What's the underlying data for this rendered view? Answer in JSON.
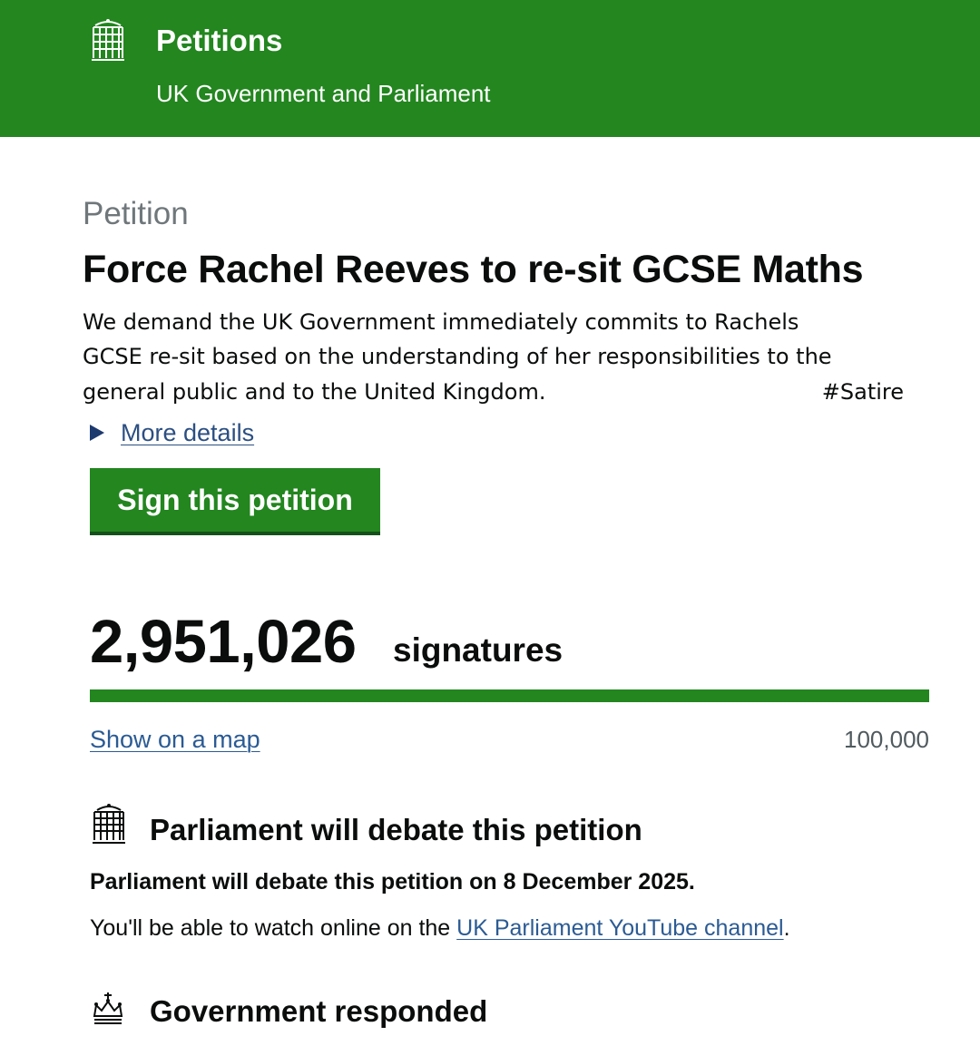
{
  "header": {
    "site_name": "Petitions",
    "subtitle": "UK Government and Parliament",
    "logo_icon": "portcullis-icon",
    "background_color": "#23861f"
  },
  "petition": {
    "caption": "Petition",
    "title": "Force Rachel Reeves to re-sit GCSE Maths",
    "description_lines": [
      "We demand the UK Government immediately commits to Rachels",
      "GCSE re-sit based on the understanding of her responsibilities to the",
      "general public and to the United Kingdom."
    ],
    "hashtag": "#Satire",
    "more_details_label": "More details",
    "sign_button_label": "Sign this petition"
  },
  "signatures": {
    "count": "2,951,026",
    "label": "signatures",
    "progress_percent": 100,
    "map_link_label": "Show on a map",
    "threshold": "100,000"
  },
  "debate": {
    "icon": "portcullis-icon",
    "heading": "Parliament will debate this petition",
    "text": "Parliament will debate this petition on 8 December 2025.",
    "watch_prefix": "You'll be able to watch online on the ",
    "watch_link": "UK Parliament YouTube channel",
    "watch_suffix": "."
  },
  "response": {
    "icon": "crown-icon",
    "heading": "Government responded"
  },
  "colors": {
    "accent_green": "#23861f",
    "link_blue": "#2b5b94",
    "text": "#0b0c0c",
    "secondary_text": "#6f777b"
  }
}
